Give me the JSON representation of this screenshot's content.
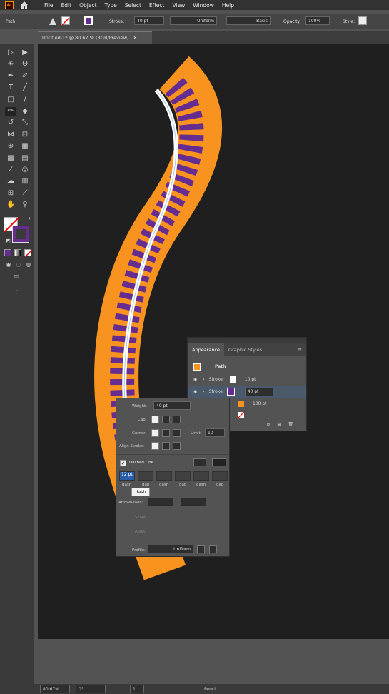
{
  "app": {
    "logo": "Ai"
  },
  "menu": [
    "File",
    "Edit",
    "Object",
    "Type",
    "Select",
    "Effect",
    "View",
    "Window",
    "Help"
  ],
  "control_bar": {
    "selection_type": "Path",
    "stroke_label": "Stroke:",
    "stroke_weight": "40 pt",
    "profile": "Uniform",
    "brush": "Basic",
    "opacity_label": "Opacity:",
    "opacity": "100%",
    "style_label": "Style:"
  },
  "document_tab": {
    "title": "Untitled-1* @ 80.67 % (RGB/Preview)"
  },
  "appearance_panel": {
    "tabs": [
      "Appearance",
      "Graphic Styles"
    ],
    "object": "Path",
    "rows": [
      {
        "label": "Stroke:",
        "value": "10 pt"
      },
      {
        "label": "Stroke:",
        "value": "40 pt"
      },
      {
        "label": "",
        "value": "100 pt"
      }
    ]
  },
  "stroke_panel": {
    "weight_label": "Weight:",
    "weight": "40 pt",
    "cap_label": "Cap:",
    "corner_label": "Corner:",
    "limit_label": "Limit:",
    "limit": "10",
    "align_label": "Align Stroke:",
    "dashed_label": "Dashed Line",
    "dash_values": [
      "12 pt",
      "",
      "",
      "",
      "",
      ""
    ],
    "dash_labels": [
      "dash",
      "gap",
      "dash",
      "gap",
      "dash",
      "gap"
    ],
    "arrowheads_label": "Arrowheads:",
    "scale_label": "Scale:",
    "align_arrow_label": "Align:",
    "profile_label": "Profile:",
    "profile": "Uniform",
    "tooltip": "dash"
  },
  "status_bar": {
    "zoom": "80.67%",
    "rotation": "0°",
    "artboard": "1",
    "tool": "Pencil"
  },
  "colors": {
    "orange": "#f7931e",
    "purple": "#662d91",
    "canvas": "#1f1f1f"
  }
}
